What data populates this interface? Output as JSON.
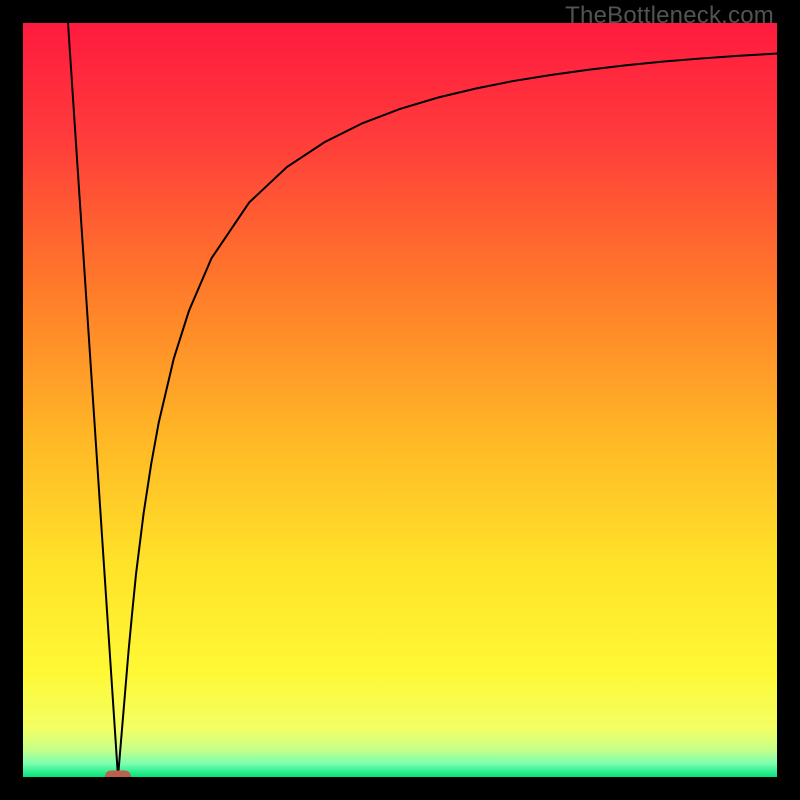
{
  "watermark": "TheBottleneck.com",
  "chart_data": {
    "type": "line",
    "title": "",
    "xlabel": "",
    "ylabel": "",
    "xlim": [
      0,
      100
    ],
    "ylim": [
      0,
      100
    ],
    "grid": false,
    "background": {
      "type": "vertical-gradient",
      "stops": [
        {
          "pos": 0.0,
          "color": "#ff1a3f"
        },
        {
          "pos": 0.15,
          "color": "#ff3b3b"
        },
        {
          "pos": 0.35,
          "color": "#ff7a2a"
        },
        {
          "pos": 0.55,
          "color": "#ffb726"
        },
        {
          "pos": 0.72,
          "color": "#ffe329"
        },
        {
          "pos": 0.86,
          "color": "#fff835"
        },
        {
          "pos": 0.935,
          "color": "#f3ff63"
        },
        {
          "pos": 0.963,
          "color": "#c9ff88"
        },
        {
          "pos": 0.982,
          "color": "#7cffb0"
        },
        {
          "pos": 1.0,
          "color": "#00e47a"
        }
      ]
    },
    "annotations": [
      {
        "type": "marker",
        "shape": "rounded-rect",
        "x": 12.6,
        "y": 0,
        "color": "#bb604e"
      }
    ],
    "series": [
      {
        "name": "curve",
        "stroke": "#000000",
        "stroke_width": 2,
        "x": [
          5.97,
          6.5,
          7.0,
          7.5,
          8.0,
          8.5,
          9.0,
          9.5,
          10.0,
          10.5,
          11.0,
          11.2,
          11.4,
          11.6,
          11.8,
          12.0,
          12.2,
          12.4,
          12.6,
          12.8,
          13.0,
          13.2,
          13.4,
          13.6,
          13.8,
          14.0,
          14.5,
          15.0,
          16.0,
          17.0,
          18.0,
          20.0,
          22.0,
          25.0,
          30.0,
          35.0,
          40.0,
          45.0,
          50.0,
          55.0,
          60.0,
          65.0,
          70.0,
          75.0,
          80.0,
          85.0,
          90.0,
          95.0,
          100.0
        ],
        "y": [
          100.0,
          92.0,
          84.46,
          76.92,
          69.38,
          61.84,
          54.3,
          46.76,
          39.22,
          31.68,
          24.14,
          21.12,
          18.11,
          15.09,
          12.08,
          9.06,
          6.04,
          3.03,
          0.0,
          2.39,
          4.78,
          7.16,
          9.55,
          11.94,
          14.33,
          16.72,
          22.0,
          27.0,
          35.0,
          41.5,
          47.0,
          55.5,
          61.8,
          68.8,
          76.2,
          80.9,
          84.2,
          86.7,
          88.6,
          90.1,
          91.3,
          92.3,
          93.1,
          93.8,
          94.4,
          94.9,
          95.3,
          95.65,
          95.95
        ]
      }
    ]
  }
}
